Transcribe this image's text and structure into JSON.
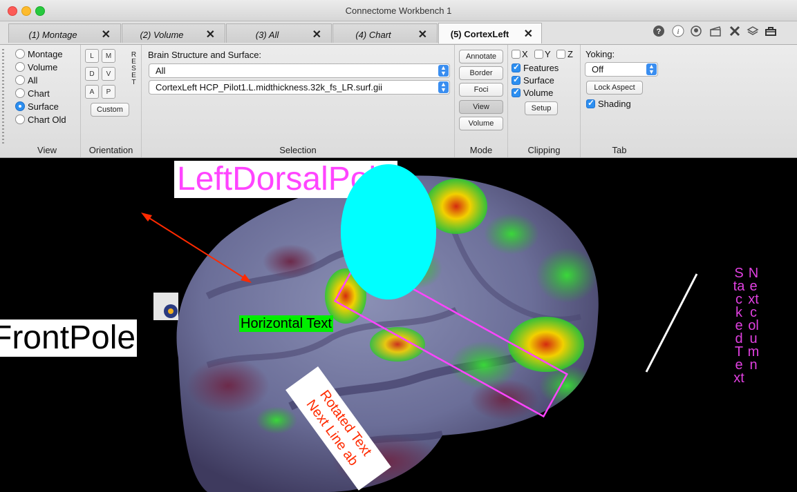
{
  "window": {
    "title": "Connectome Workbench 1"
  },
  "tabs": [
    {
      "label": "(1) Montage",
      "close": "✕"
    },
    {
      "label": "(2) Volume",
      "close": "✕"
    },
    {
      "label": "(3) All",
      "close": "✕"
    },
    {
      "label": "(4) Chart",
      "close": "✕"
    },
    {
      "label": "(5) CortexLeft",
      "close": "✕",
      "active": true
    }
  ],
  "tabbar_icons": [
    "help-icon",
    "info-icon",
    "identify-icon",
    "movie-icon",
    "tools-icon",
    "layers-icon",
    "toolbox-icon"
  ],
  "toolbar": {
    "view": {
      "label": "View",
      "options": [
        "Montage",
        "Volume",
        "All",
        "Chart",
        "Surface",
        "Chart Old"
      ],
      "selected": "Surface"
    },
    "orientation": {
      "label": "Orientation",
      "view_buttons": [
        "L",
        "M",
        "D",
        "V",
        "A",
        "P"
      ],
      "reset": "RESET",
      "custom": "Custom"
    },
    "selection": {
      "label": "Selection",
      "heading": "Brain Structure and Surface:",
      "structure": "All",
      "surface": "CortexLeft HCP_Pilot1.L.midthickness.32k_fs_LR.surf.gii"
    },
    "mode": {
      "label": "Mode",
      "buttons": [
        "Annotate",
        "Border",
        "Foci",
        "View",
        "Volume"
      ],
      "pressed": "View"
    },
    "clipping": {
      "label": "Clipping",
      "axes": [
        "X",
        "Y",
        "Z"
      ],
      "features": "Features",
      "surface": "Surface",
      "volume": "Volume",
      "setup": "Setup"
    },
    "tab": {
      "label": "Tab",
      "yoking_label": "Yoking:",
      "yoking_value": "Off",
      "lock_aspect": "Lock Aspect",
      "shading": "Shading"
    }
  },
  "annotations": {
    "left_dorsal": "LeftDorsalPole",
    "front_pole": "FrontPole",
    "horizontal": "Horizontal Text",
    "rotated_line1": "Rotated Text",
    "rotated_line2": "Next Line  ab",
    "stacked1": "Stacked Text",
    "stacked2": "Next column",
    "colors": {
      "magenta": "#ff44ff",
      "cyan": "#00ffff",
      "green_bg": "#00ee00",
      "red_arrow": "#ff2a00",
      "rotated_text": "#ff2a00",
      "stacked_text": "#e040e0"
    }
  }
}
